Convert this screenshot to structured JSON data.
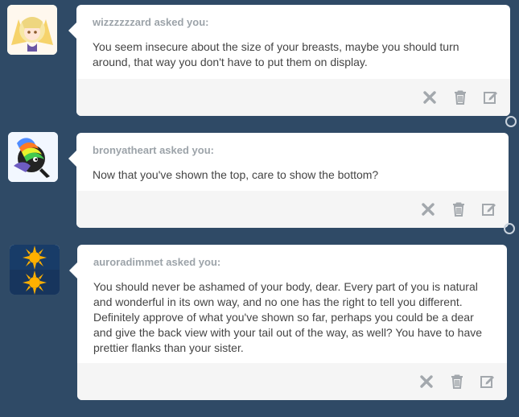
{
  "colors": {
    "page_background": "#2f4a66",
    "card_background": "#ffffff",
    "footer_background": "#f5f5f5",
    "asker_text": "#9ca3a9",
    "question_text": "#444444",
    "action_icon": "#a3a8ad"
  },
  "questions": [
    {
      "asker": "wizzzzzzard asked you:",
      "avatar_icon": "fox-girl-avatar",
      "text": "You seem insecure about the size of your breasts, maybe you should turn around, that way you don't have to put them on display.",
      "actions": [
        "delete-icon",
        "trash-icon",
        "edit-icon"
      ]
    },
    {
      "asker": "bronyatheart asked you:",
      "avatar_icon": "pony-avatar",
      "text": "Now that you've shown the top, care to show the bottom?",
      "actions": [
        "delete-icon",
        "trash-icon",
        "edit-icon"
      ]
    },
    {
      "asker": "auroradimmet asked you:",
      "avatar_icon": "sun-avatar",
      "text": "You should never be ashamed of your body, dear. Every part of you is natural and wonderful in its own way, and no one has the right to tell you different. Definitely approve of what you've shown so far, perhaps you could be a dear and give the back view with your tail out of the way, as well? You have to have prettier flanks than your sister.",
      "actions": [
        "delete-icon",
        "trash-icon",
        "edit-icon"
      ]
    }
  ]
}
